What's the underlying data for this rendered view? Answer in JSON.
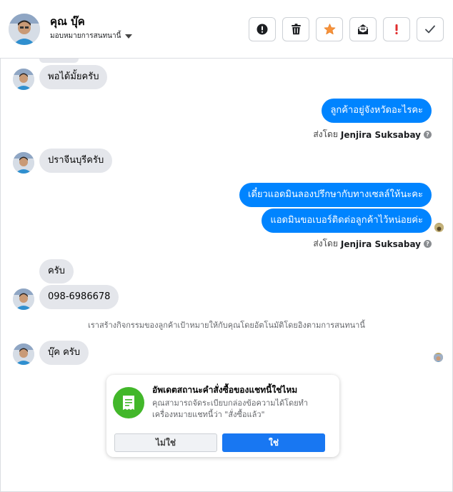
{
  "header": {
    "contact_name": "คุณ บุ๊ค",
    "assign_label": "มอบหมายการสนทนานี้",
    "toolbar": {
      "spam": "exclamation-circle-icon",
      "delete": "trash-icon",
      "star": "star-icon",
      "mark_unread": "envelope-icon",
      "follow_up": "exclamation-icon",
      "done": "checkmark-icon"
    }
  },
  "messages": {
    "m1": "พอได้มั้ยครับ",
    "m2": "ลูกค้าอยู่จังหวัดอะไรคะ",
    "sent_by_prefix_1": "ส่งโดย",
    "sent_by_name_1": "Jenjira Suksabay",
    "m3": "ปราจีนบุรีครับ",
    "m4": "เดี๋ยวแอดมินลองปรึกษากับทางเซลล์ให้นะคะ",
    "m5": "แอดมินขอเบอร์ติดต่อลูกค้าไว้หน่อยค่ะ",
    "sent_by_prefix_2": "ส่งโดย",
    "sent_by_name_2": "Jenjira Suksabay",
    "m6": "ครับ",
    "m7": "098-6986678",
    "system": "เราสร้างกิจกรรมของลูกค้าเป้าหมายให้กับคุณโดยอัตโนมัติโดยอิงตามการสนทนานี้",
    "m8": "บุ๊ค ครับ"
  },
  "card": {
    "title": "อัพเดตสถานะคำสั่งซื้อของแชทนี้ใช่ไหม",
    "body": "คุณสามารถจัดระเบียบกล่องข้อความได้โดยทำเครื่องหมายแชทนี้ว่า \"สั่งซื้อแล้ว\"",
    "no_label": "ไม่ใช่",
    "yes_label": "ใช่"
  },
  "colors": {
    "outgoing_bubble": "#0084ff",
    "incoming_bubble": "#e4e6eb",
    "star": "#f7923b",
    "follow_up": "#e02e2e",
    "card_icon_bg": "#42b72a",
    "primary_button": "#1877f2"
  }
}
